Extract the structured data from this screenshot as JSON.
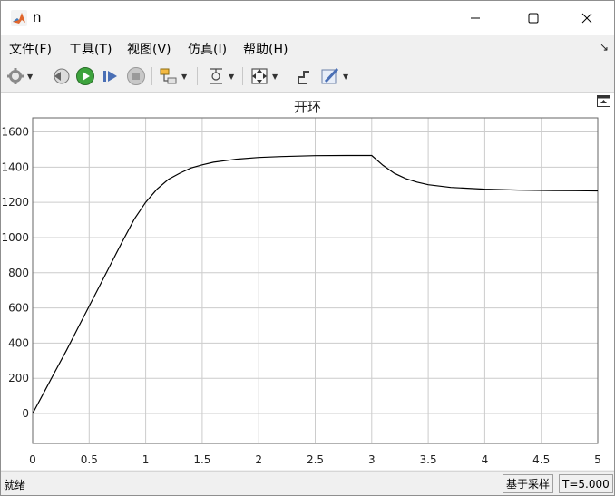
{
  "window": {
    "title": "n",
    "controls": [
      "minimize-icon",
      "maximize-icon",
      "close-icon"
    ]
  },
  "menu": {
    "items": [
      "文件(F)",
      "工具(T)",
      "视图(V)",
      "仿真(I)",
      "帮助(H)"
    ]
  },
  "toolbar": {
    "icons": [
      "gear-icon",
      "step-back-icon",
      "run-icon",
      "step-forward-icon",
      "stop-icon",
      "signal-highlight-icon",
      "cursor-measure-icon",
      "zoom-fit-icon",
      "style-icon",
      "edit-icon"
    ]
  },
  "plot": {
    "title": "开环",
    "background": "#ffffff",
    "line_color": "#000000",
    "grid_color": "#cccccc"
  },
  "chart_data": {
    "type": "line",
    "title": "开环",
    "xlabel": "",
    "ylabel": "",
    "xlim": [
      0,
      5
    ],
    "ylim": [
      -170,
      1680
    ],
    "xticks": [
      "0",
      "0.5",
      "1",
      "1.5",
      "2",
      "2.5",
      "3",
      "3.5",
      "4",
      "4.5",
      "5"
    ],
    "yticks": [
      "0",
      "200",
      "400",
      "600",
      "800",
      "1000",
      "1200",
      "1400",
      "1600"
    ],
    "grid": true,
    "series": [
      {
        "x": [
          0,
          0.1,
          0.2,
          0.3,
          0.4,
          0.5,
          0.6,
          0.7,
          0.8,
          0.9,
          1.0,
          1.1,
          1.2,
          1.3,
          1.4,
          1.5,
          1.6,
          1.8,
          2.0,
          2.2,
          2.5,
          2.8,
          3.0,
          3.1,
          3.2,
          3.3,
          3.4,
          3.5,
          3.7,
          4.0,
          4.3,
          4.6,
          5.0
        ],
        "y": [
          0,
          120,
          240,
          360,
          485,
          610,
          735,
          860,
          985,
          1105,
          1200,
          1275,
          1330,
          1365,
          1395,
          1413,
          1428,
          1445,
          1455,
          1460,
          1465,
          1466,
          1466,
          1410,
          1365,
          1335,
          1315,
          1300,
          1285,
          1275,
          1270,
          1267,
          1265
        ]
      }
    ]
  },
  "status": {
    "left": "就绪",
    "mode": "基于采样",
    "time": "T=5.000"
  }
}
